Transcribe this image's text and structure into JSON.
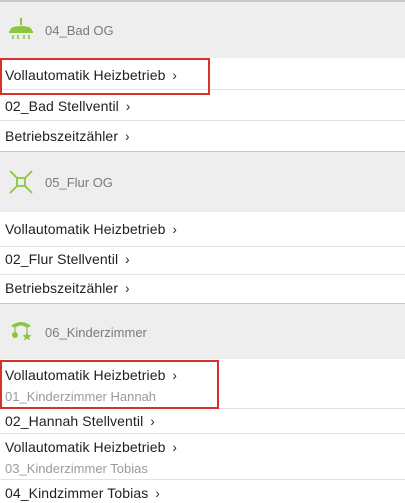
{
  "sections": [
    {
      "title": "04_Bad OG",
      "icon": "shower-icon",
      "items": [
        {
          "label": "Vollautomatik Heizbetrieb"
        },
        {
          "label": "02_Bad Stellventil"
        },
        {
          "label": "Betriebszeitzähler"
        }
      ]
    },
    {
      "title": "05_Flur OG",
      "icon": "hallway-icon",
      "items": [
        {
          "label": "Vollautomatik Heizbetrieb"
        },
        {
          "label": "02_Flur Stellventil"
        },
        {
          "label": "Betriebszeitzähler"
        }
      ]
    },
    {
      "title": "06_Kinderzimmer",
      "icon": "baby-mobile-icon",
      "items": [
        {
          "label": "Vollautomatik Heizbetrieb",
          "sublabel": "01_Kinderzimmer Hannah"
        },
        {
          "label": "02_Hannah Stellventil"
        },
        {
          "label": "Vollautomatik Heizbetrieb",
          "sublabel": "03_Kinderzimmer Tobias"
        },
        {
          "label": "04_Kindzimmer Tobias"
        }
      ]
    }
  ],
  "chevron": "›",
  "accent_color": "#8cc63f",
  "highlight_color": "#d9302c"
}
